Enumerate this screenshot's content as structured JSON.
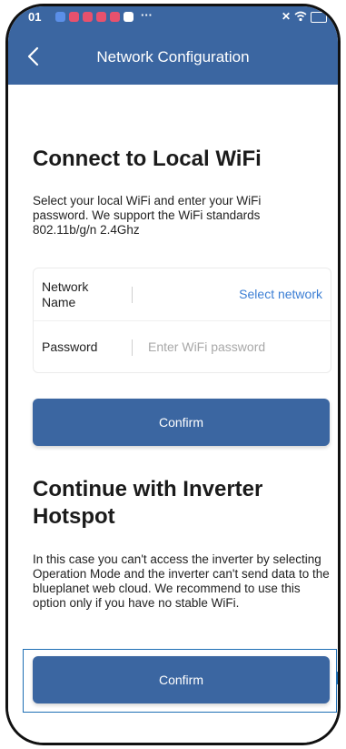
{
  "status_bar": {
    "time": "01",
    "more": "···",
    "icons": [
      "notification-icon",
      "wifi-icon",
      "battery-icon"
    ]
  },
  "nav": {
    "title": "Network Configuration",
    "back_icon": "chevron-left-icon"
  },
  "local_wifi": {
    "heading": "Connect to Local WiFi",
    "description": "Select your local WiFi and enter your WiFi password. We support the WiFi standards 802.11b/g/n 2.4Ghz",
    "network_label": "Network Name",
    "select_network": "Select network",
    "password_label": "Password",
    "password_placeholder": "Enter WiFi password",
    "password_value": "",
    "confirm_label": "Confirm"
  },
  "hotspot": {
    "heading": "Continue with Inverter Hotspot",
    "description": "In this case you can't access the inverter by selecting Operation Mode and the inverter can't send data to the blueplanet web cloud. We recommend to use this option only if you have no stable WiFi.",
    "confirm_label": "Confirm"
  },
  "colors": {
    "primary": "#3b66a1",
    "link": "#3b7ed4",
    "highlight": "#1f6fb4"
  }
}
